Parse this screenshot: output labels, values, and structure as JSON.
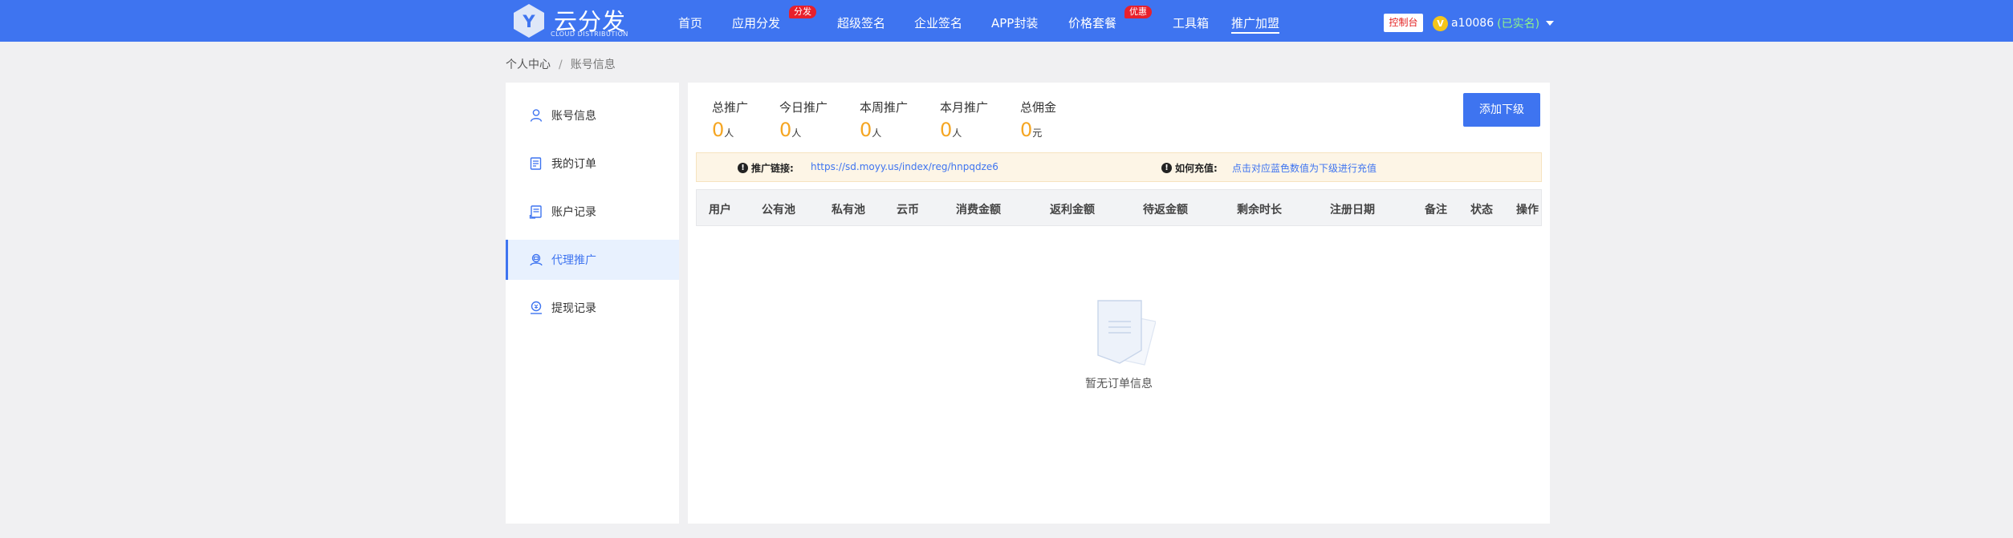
{
  "header": {
    "logo": {
      "letter": "Y",
      "cn": "云分发",
      "en": "CLOUD DISTRIBUTION"
    },
    "nav": [
      {
        "label": "首页",
        "badge": null,
        "active": false
      },
      {
        "label": "应用分发",
        "badge": "分发",
        "active": false
      },
      {
        "label": "超级签名",
        "badge": null,
        "active": false
      },
      {
        "label": "企业签名",
        "badge": null,
        "active": false
      },
      {
        "label": "APP封装",
        "badge": null,
        "active": false
      },
      {
        "label": "价格套餐",
        "badge": "优惠",
        "active": false
      },
      {
        "label": "工具箱",
        "badge": null,
        "active": false
      },
      {
        "label": "推广加盟",
        "badge": null,
        "active": true
      }
    ],
    "console_label": "控制台",
    "user": {
      "coin": "V",
      "name": "a10086",
      "status": "(已实名)"
    }
  },
  "breadcrumb": {
    "root": "个人中心",
    "sep": "/",
    "current": "账号信息"
  },
  "sidebar": {
    "items": [
      {
        "label": "账号信息",
        "icon": "user-icon",
        "active": false
      },
      {
        "label": "我的订单",
        "icon": "order-icon",
        "active": false
      },
      {
        "label": "账户记录",
        "icon": "record-icon",
        "active": false
      },
      {
        "label": "代理推广",
        "icon": "agent-icon",
        "active": true
      },
      {
        "label": "提现记录",
        "icon": "withdraw-icon",
        "active": false
      }
    ]
  },
  "stats": [
    {
      "label": "总推广",
      "value": "0",
      "unit": "人"
    },
    {
      "label": "今日推广",
      "value": "0",
      "unit": "人"
    },
    {
      "label": "本周推广",
      "value": "0",
      "unit": "人"
    },
    {
      "label": "本月推广",
      "value": "0",
      "unit": "人"
    },
    {
      "label": "总佣金",
      "value": "0",
      "unit": "元"
    }
  ],
  "add_button": "添加下级",
  "info": {
    "promo_label": "推广链接:",
    "promo_link": "https://sd.moyy.us/index/reg/hnpqdze6",
    "recharge_label": "如何充值:",
    "recharge_text": "点击对应蓝色数值为下级进行充值"
  },
  "table": {
    "columns": [
      "用户",
      "公有池",
      "私有池",
      "云币",
      "消费金额",
      "返利金额",
      "待返金额",
      "剩余时长",
      "注册日期",
      "备注",
      "状态",
      "操作"
    ]
  },
  "empty_text": "暂无订单信息",
  "colors": {
    "primary": "#3e74f0",
    "accent": "#f5a623",
    "badge": "#e8202c"
  }
}
